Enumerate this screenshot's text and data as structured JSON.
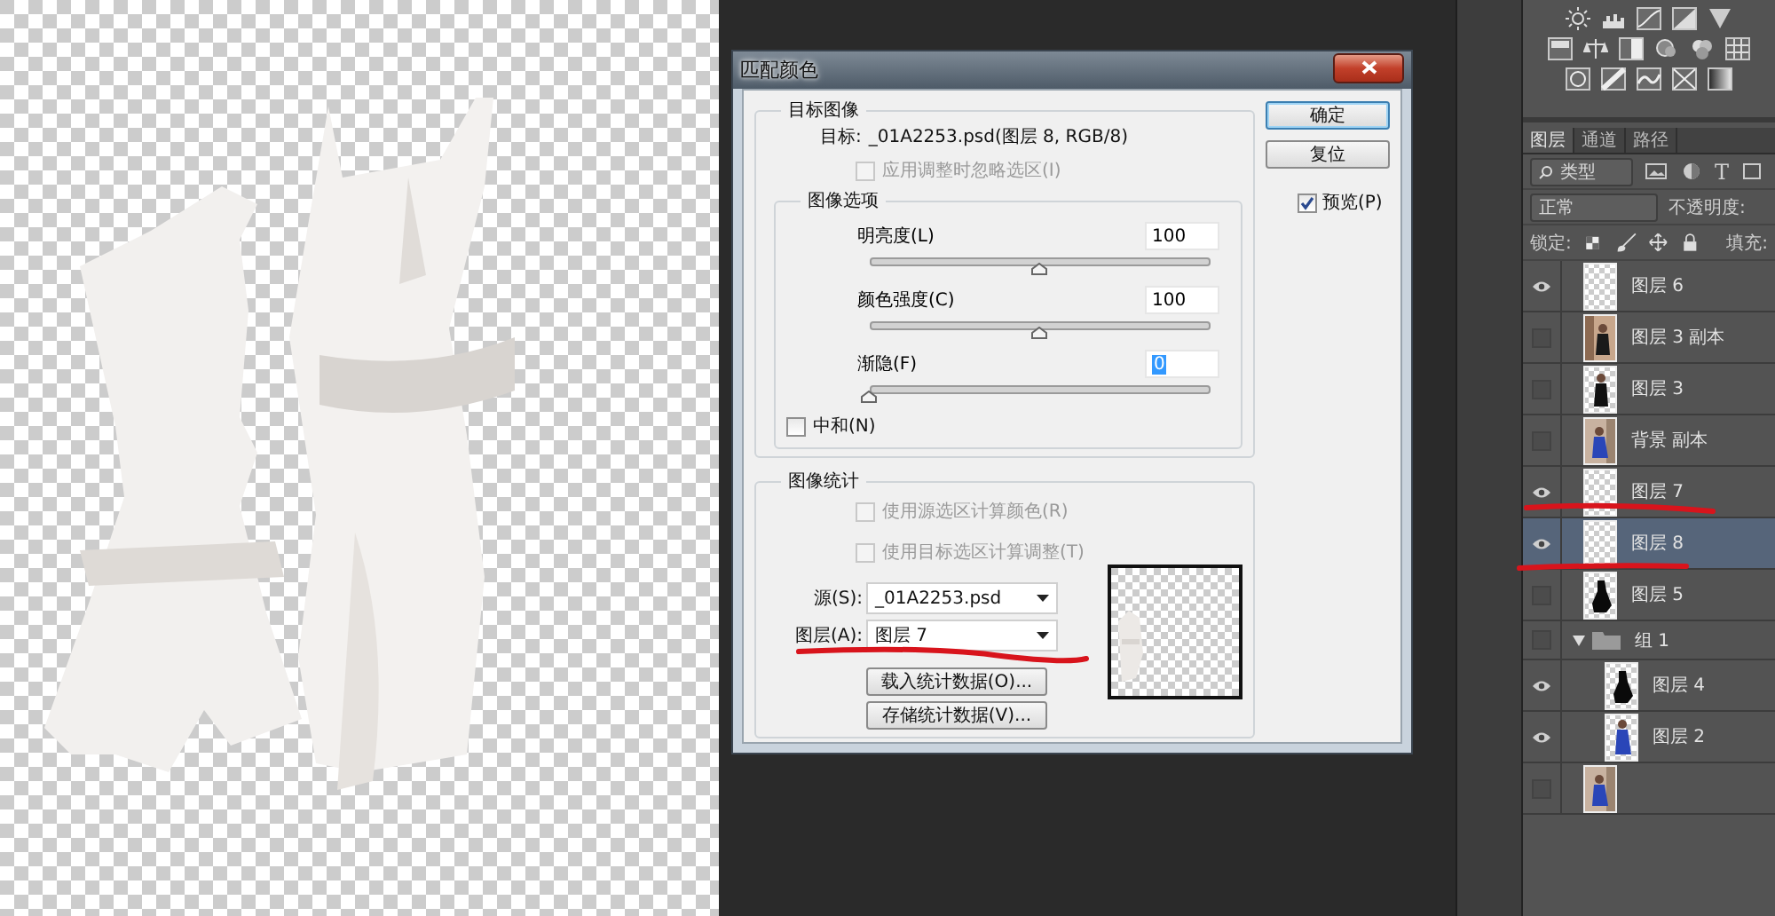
{
  "dialog": {
    "title": "匹配颜色",
    "target_group": {
      "title": "目标图像",
      "target_label": "目标:",
      "target_value": "_01A2253.psd(图层 8, RGB/8)",
      "ignore_selection": {
        "label": "应用调整时忽略选区(I)",
        "checked": false,
        "disabled": true
      }
    },
    "options_group": {
      "title": "图像选项",
      "sliders": [
        {
          "label": "明亮度(L)",
          "value": "100",
          "level": 0.5,
          "focused": false
        },
        {
          "label": "颜色强度(C)",
          "value": "100",
          "level": 0.5,
          "focused": false
        },
        {
          "label": "渐隐(F)",
          "value": "0",
          "level": 0,
          "focused": true
        }
      ],
      "neutralize": {
        "label": "中和(N)",
        "checked": false,
        "disabled": false
      }
    },
    "stats_group": {
      "title": "图像统计",
      "checkboxes": [
        {
          "label": "使用源选区计算颜色(R)",
          "checked": false,
          "disabled": true
        },
        {
          "label": "使用目标选区计算调整(T)",
          "checked": false,
          "disabled": true
        }
      ],
      "source": {
        "label": "源(S):",
        "value": "_01A2253.psd"
      },
      "layer": {
        "label": "图层(A):",
        "value": "图层 7"
      },
      "buttons": [
        "载入统计数据(O)...",
        "存储统计数据(V)..."
      ]
    },
    "buttons": [
      {
        "label": "确定",
        "default": true
      },
      {
        "label": "复位",
        "default": false
      }
    ],
    "preview": {
      "label": "预览(P)",
      "checked": true
    }
  },
  "layers_panel": {
    "tabs": [
      {
        "label": "图层",
        "selected": true
      },
      {
        "label": "通道",
        "selected": false
      },
      {
        "label": "路径",
        "selected": false
      }
    ],
    "filter": "类型",
    "text_tool": "T",
    "blend_mode": "正常",
    "opacity_label": "不透明度:",
    "lock_label": "锁定:",
    "fill_label": "填充:",
    "layers": [
      {
        "kind": "layer",
        "name": "图层 6",
        "visible": true,
        "selected": false
      },
      {
        "kind": "layer",
        "name": "图层 3 副本",
        "visible": false,
        "selected": false
      },
      {
        "kind": "layer",
        "name": "图层 3",
        "visible": false,
        "selected": false
      },
      {
        "kind": "layer",
        "name": "背景 副本",
        "visible": false,
        "selected": false
      },
      {
        "kind": "layer",
        "name": "图层 7",
        "visible": true,
        "selected": false
      },
      {
        "kind": "layer",
        "name": "图层 8",
        "visible": true,
        "selected": true
      },
      {
        "kind": "layer",
        "name": "图层 5",
        "visible": false,
        "selected": false
      },
      {
        "kind": "group",
        "name": "组 1",
        "visible": false,
        "selected": false,
        "expanded": true,
        "children": [
          {
            "kind": "layer",
            "name": "图层 4",
            "visible": true,
            "selected": false
          },
          {
            "kind": "layer",
            "name": "图层 2",
            "visible": true,
            "selected": false
          }
        ]
      },
      {
        "kind": "layer",
        "visible": false,
        "selected": false
      }
    ]
  }
}
